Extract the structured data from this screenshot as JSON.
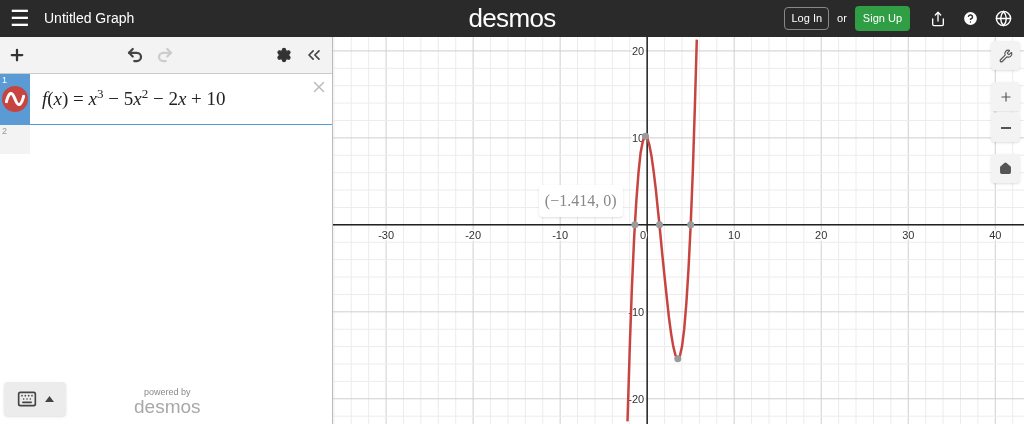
{
  "header": {
    "menu": "☰",
    "title": "Untitled Graph",
    "logo": "desmos",
    "login": "Log In",
    "or": "or",
    "signup": "Sign Up"
  },
  "expressions": [
    {
      "number": "1",
      "color": "#c74440",
      "selected": true,
      "parts": [
        {
          "text": "f",
          "kind": "variable"
        },
        {
          "text": "(",
          "kind": "symbol"
        },
        {
          "text": "x",
          "kind": "variable"
        },
        {
          "text": ") = ",
          "kind": "symbol"
        },
        {
          "text": "x",
          "kind": "variable"
        },
        {
          "text": "3",
          "kind": "exponent"
        },
        {
          "text": " − 5",
          "kind": "symbol"
        },
        {
          "text": "x",
          "kind": "variable"
        },
        {
          "text": "2",
          "kind": "exponent"
        },
        {
          "text": " − 2",
          "kind": "symbol"
        },
        {
          "text": "x",
          "kind": "variable"
        },
        {
          "text": " + 10",
          "kind": "symbol"
        }
      ]
    },
    {
      "number": "2",
      "selected": false
    }
  ],
  "footer": {
    "powered_by": "powered by",
    "brand": "desmos"
  },
  "graph": {
    "chart_data": {
      "type": "line",
      "grid": true,
      "xlim": [
        -36.1,
        43.3
      ],
      "ylim": [
        -22.9,
        21.6
      ],
      "xticks": [
        {
          "value": -30,
          "label": "-30"
        },
        {
          "value": -20,
          "label": "-20"
        },
        {
          "value": -10,
          "label": "-10"
        },
        {
          "value": 0,
          "label": "0"
        },
        {
          "value": 10,
          "label": "10"
        },
        {
          "value": 20,
          "label": "20"
        },
        {
          "value": 30,
          "label": "30"
        },
        {
          "value": 40,
          "label": "40"
        }
      ],
      "yticks": [
        {
          "value": 20,
          "label": "20"
        },
        {
          "value": 10,
          "label": "10"
        },
        {
          "value": -10,
          "label": "-10"
        },
        {
          "value": -20,
          "label": "-20"
        }
      ],
      "x": [
        -2.26,
        -2,
        -1.75,
        -1.5,
        -1.414,
        -1.25,
        -1,
        -0.75,
        -0.5,
        -0.25,
        -0.19,
        0,
        0.25,
        0.5,
        0.75,
        1,
        1.25,
        1.414,
        1.5,
        1.75,
        2,
        2.25,
        2.5,
        2.75,
        3,
        3.25,
        3.5,
        3.52,
        3.75,
        4,
        4.25,
        4.5,
        4.75,
        5,
        5.25,
        5.5,
        5.7
      ],
      "series": [
        {
          "color": "#c74440",
          "values": [
            -22.6,
            -14,
            -7.2,
            -1.6,
            0,
            2.7,
            6,
            8.3,
            9.6,
            10.2,
            10.2,
            10,
            9.2,
            7.9,
            6.1,
            4,
            1.6,
            0,
            -0.9,
            -3.5,
            -6,
            -8.4,
            -10.6,
            -12.5,
            -14,
            -15,
            -15.4,
            -15.4,
            -15.1,
            -14,
            -12,
            -9.1,
            -5.1,
            0,
            6.4,
            14.1,
            21.3
          ]
        },
        {
          "type": "scatter",
          "color": "#9b9b9b",
          "values": [
            null,
            null,
            null,
            null,
            0,
            null,
            null,
            null,
            null,
            null,
            10.2,
            null,
            null,
            null,
            null,
            null,
            null,
            0,
            null,
            null,
            null,
            null,
            null,
            null,
            null,
            null,
            null,
            -15.4,
            null,
            null,
            null,
            null,
            null,
            0,
            null,
            null,
            null
          ]
        }
      ],
      "annotations": [
        {
          "x": -1.414,
          "y": 0,
          "text": "(−1.414, 0)"
        }
      ]
    }
  }
}
